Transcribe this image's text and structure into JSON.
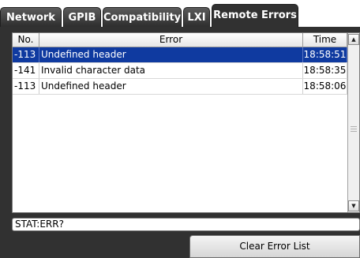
{
  "tabs": [
    {
      "label": "Network"
    },
    {
      "label": "GPIB"
    },
    {
      "label": "Compatibility"
    },
    {
      "label": "LXI"
    },
    {
      "label": "Remote Errors",
      "active": true
    }
  ],
  "table": {
    "columns": {
      "no": "No.",
      "error": "Error",
      "time": "Time"
    },
    "rows": [
      {
        "no": "-113",
        "error": "Undefined header",
        "time": "18:58:51",
        "selected": true
      },
      {
        "no": "-141",
        "error": "Invalid character data",
        "time": "18:58:35"
      },
      {
        "no": "-113",
        "error": "Undefined header",
        "time": "18:58:06"
      }
    ]
  },
  "scrollbar": {
    "up_icon": "arrow-up-icon",
    "down_icon": "arrow-down-icon"
  },
  "command": {
    "value": "STAT:ERR?"
  },
  "buttons": {
    "clear_label": "Clear Error List"
  },
  "colors": {
    "selection": "#0f3aa0",
    "panel": "#313131",
    "tab": "#4a4a4a"
  }
}
